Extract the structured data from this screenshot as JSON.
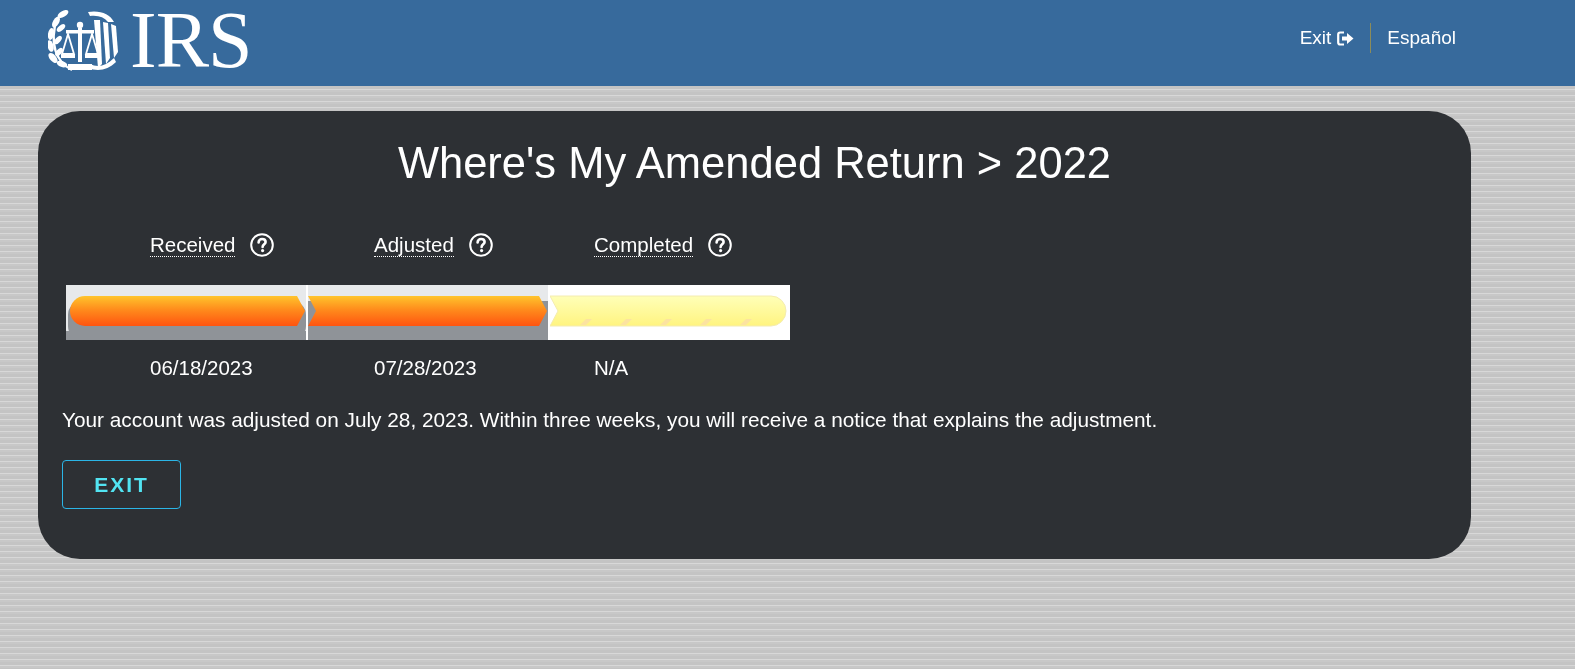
{
  "header": {
    "logo_text": "IRS",
    "links": [
      {
        "label": "Exit",
        "kind": "exit"
      },
      {
        "label": "Español",
        "kind": "language"
      }
    ]
  },
  "card": {
    "title": "Where's My Amended Return > 2022",
    "steps": [
      {
        "label": "Received",
        "date": "06/18/2023",
        "done": true
      },
      {
        "label": "Adjusted",
        "date": "07/28/2023",
        "done": true
      },
      {
        "label": "Completed",
        "date": "N/A",
        "done": false
      }
    ],
    "message": "Your account was adjusted on July 28, 2023. Within three weeks, you will receive a notice that explains the adjustment.",
    "button": "EXIT"
  }
}
